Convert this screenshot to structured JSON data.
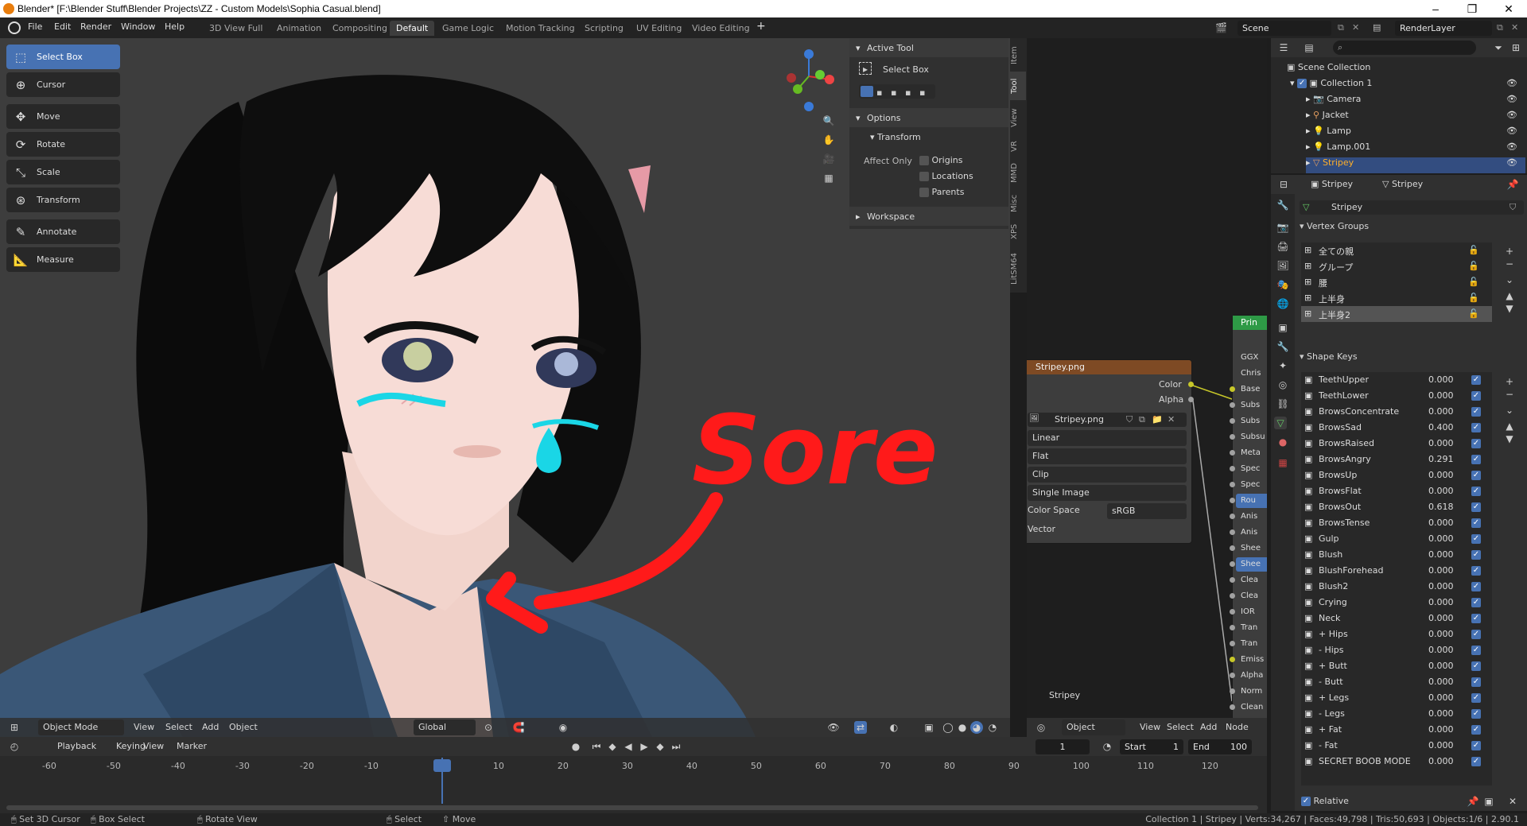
{
  "title": "Blender* [F:\\Blender Stuff\\Blender Projects\\ZZ - Custom Models\\Sophia Casual.blend]",
  "menu": [
    "File",
    "Edit",
    "Render",
    "Window",
    "Help"
  ],
  "workspaces": [
    "3D View Full",
    "Animation",
    "Compositing",
    "Default",
    "Game Logic",
    "Motion Tracking",
    "Scripting",
    "UV Editing",
    "Video Editing"
  ],
  "active_workspace": "Default",
  "scene": {
    "label": "Scene",
    "layer": "RenderLayer"
  },
  "tools": [
    "Select Box",
    "Cursor",
    "Move",
    "Rotate",
    "Scale",
    "Transform",
    "Annotate",
    "Measure"
  ],
  "tool_panel": {
    "active_tool_header": "Active Tool",
    "active_tool": "Select Box",
    "options_header": "Options",
    "transform_header": "Transform",
    "affect_only": "Affect Only",
    "origins": "Origins",
    "locations": "Locations",
    "parents": "Parents",
    "workspace_header": "Workspace"
  },
  "side_tabs": [
    "Item",
    "Tool",
    "View",
    "VR",
    "MMD",
    "Misc",
    "XPS",
    "LitSM64"
  ],
  "viewport_header": {
    "mode": "Object Mode",
    "menus": [
      "View",
      "Select",
      "Add",
      "Object"
    ],
    "orientation": "Global"
  },
  "annotation": {
    "text": "Sore"
  },
  "node_editor": {
    "image_node_title": "Stripey.png",
    "outputs": [
      "Color",
      "Alpha"
    ],
    "image_name": "Stripey.png",
    "interpolation": "Linear",
    "projection": "Flat",
    "extension": "Clip",
    "source": "Single Image",
    "color_space_label": "Color Space",
    "color_space": "sRGB",
    "vector": "Vector",
    "principled_title": "Prin",
    "principled_rows": [
      "GGX",
      "Chris",
      "Base",
      "Subs",
      "Subs",
      "Subsu",
      "Meta",
      "Spec",
      "Spec",
      "Rou",
      "Anis",
      "Anis",
      "Shee",
      "Shee",
      "Clea",
      "Clea",
      "IOR",
      "Tran",
      "Tran",
      "Emiss",
      "Alpha",
      "Norm",
      "Clean"
    ],
    "material_name": "Stripey",
    "header": {
      "mode": "Object",
      "menus": [
        "View",
        "Select",
        "Add",
        "Node"
      ]
    }
  },
  "outliner": {
    "root": "Scene Collection",
    "collection": "Collection 1",
    "items": [
      "Camera",
      "Jacket",
      "Lamp",
      "Lamp.001",
      "Stripey"
    ]
  },
  "properties": {
    "object": "Stripey",
    "mesh": "Stripey",
    "data_name": "Stripey",
    "vertex_groups_header": "Vertex Groups",
    "vertex_groups": [
      "全ての親",
      "グループ",
      "腰",
      "上半身",
      "上半身2"
    ],
    "shape_keys_header": "Shape Keys",
    "shape_keys": [
      {
        "name": "TeethUpper",
        "value": "0.000"
      },
      {
        "name": "TeethLower",
        "value": "0.000"
      },
      {
        "name": "BrowsConcentrate",
        "value": "0.000"
      },
      {
        "name": "BrowsSad",
        "value": "0.400"
      },
      {
        "name": "BrowsRaised",
        "value": "0.000"
      },
      {
        "name": "BrowsAngry",
        "value": "0.291"
      },
      {
        "name": "BrowsUp",
        "value": "0.000"
      },
      {
        "name": "BrowsFlat",
        "value": "0.000"
      },
      {
        "name": "BrowsOut",
        "value": "0.618"
      },
      {
        "name": "BrowsTense",
        "value": "0.000"
      },
      {
        "name": "Gulp",
        "value": "0.000"
      },
      {
        "name": "Blush",
        "value": "0.000"
      },
      {
        "name": "BlushForehead",
        "value": "0.000"
      },
      {
        "name": "Blush2",
        "value": "0.000"
      },
      {
        "name": "Crying",
        "value": "0.000"
      },
      {
        "name": "Neck",
        "value": "0.000"
      },
      {
        "name": "+ Hips",
        "value": "0.000"
      },
      {
        "name": "- Hips",
        "value": "0.000"
      },
      {
        "name": "+ Butt",
        "value": "0.000"
      },
      {
        "name": "- Butt",
        "value": "0.000"
      },
      {
        "name": "+ Legs",
        "value": "0.000"
      },
      {
        "name": "- Legs",
        "value": "0.000"
      },
      {
        "name": "+ Fat",
        "value": "0.000"
      },
      {
        "name": "- Fat",
        "value": "0.000"
      },
      {
        "name": "SECRET BOOB MODE",
        "value": "0.000"
      }
    ],
    "relative": "Relative"
  },
  "timeline": {
    "menus": [
      "Playback",
      "Keying",
      "View",
      "Marker"
    ],
    "current_frame": "1",
    "start_label": "Start",
    "start": "1",
    "end_label": "End",
    "end": "100",
    "ticks": [
      "-60",
      "-50",
      "-40",
      "-30",
      "-20",
      "-10",
      "1",
      "10",
      "20",
      "30",
      "40",
      "50",
      "60",
      "70",
      "80",
      "90",
      "100",
      "110",
      "120"
    ]
  },
  "status": {
    "left": [
      "Set 3D Cursor",
      "Box Select",
      "Rotate View",
      "Select",
      "Move"
    ],
    "right": "Collection 1 | Stripey | Verts:34,267 | Faces:49,798 | Tris:50,693 | Objects:1/6 | 2.90.1"
  },
  "colors": {
    "accent": "#4772b3",
    "annotation": "#ff1a1a",
    "tear": "#1ad6e6",
    "image_node": "#7e4a24",
    "principled": "#2e9a46"
  }
}
